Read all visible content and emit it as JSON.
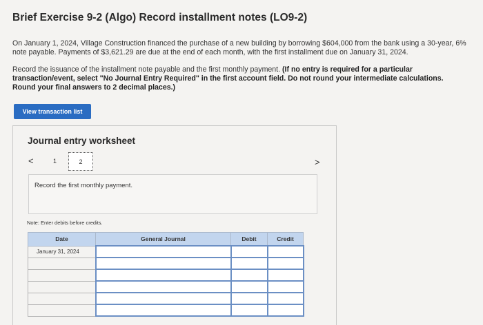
{
  "header": {
    "title": "Brief Exercise 9-2 (Algo) Record installment notes (LO9-2)"
  },
  "problem": {
    "paragraph1": "On January 1, 2024, Village Construction financed the purchase of a new building by borrowing $604,000 from the bank using a 30-year, 6% note payable. Payments of $3,621.29 are due at the end of each month, with the first installment due on January 31, 2024.",
    "paragraph2_plain": "Record the issuance of the installment note payable and the first monthly payment. ",
    "paragraph2_bold": "(If no entry is required for a particular transaction/event, select \"No Journal Entry Required\" in the first account field. Do not round your intermediate calculations. Round your final answers to 2 decimal places.)"
  },
  "buttons": {
    "view_transaction_list": "View transaction list"
  },
  "worksheet": {
    "title": "Journal entry worksheet",
    "nav_prev": "<",
    "nav_next": ">",
    "pages": [
      "1",
      "2"
    ],
    "current_page": "2",
    "instruction": "Record the first monthly payment.",
    "note": "Note: Enter debits before credits.",
    "table": {
      "headers": [
        "Date",
        "General Journal",
        "Debit",
        "Credit"
      ],
      "rows": [
        {
          "date": "January 31, 2024",
          "account": "",
          "debit": "",
          "credit": ""
        },
        {
          "date": "",
          "account": "",
          "debit": "",
          "credit": ""
        },
        {
          "date": "",
          "account": "",
          "debit": "",
          "credit": ""
        },
        {
          "date": "",
          "account": "",
          "debit": "",
          "credit": ""
        },
        {
          "date": "",
          "account": "",
          "debit": "",
          "credit": ""
        },
        {
          "date": "",
          "account": "",
          "debit": "",
          "credit": ""
        }
      ]
    }
  }
}
